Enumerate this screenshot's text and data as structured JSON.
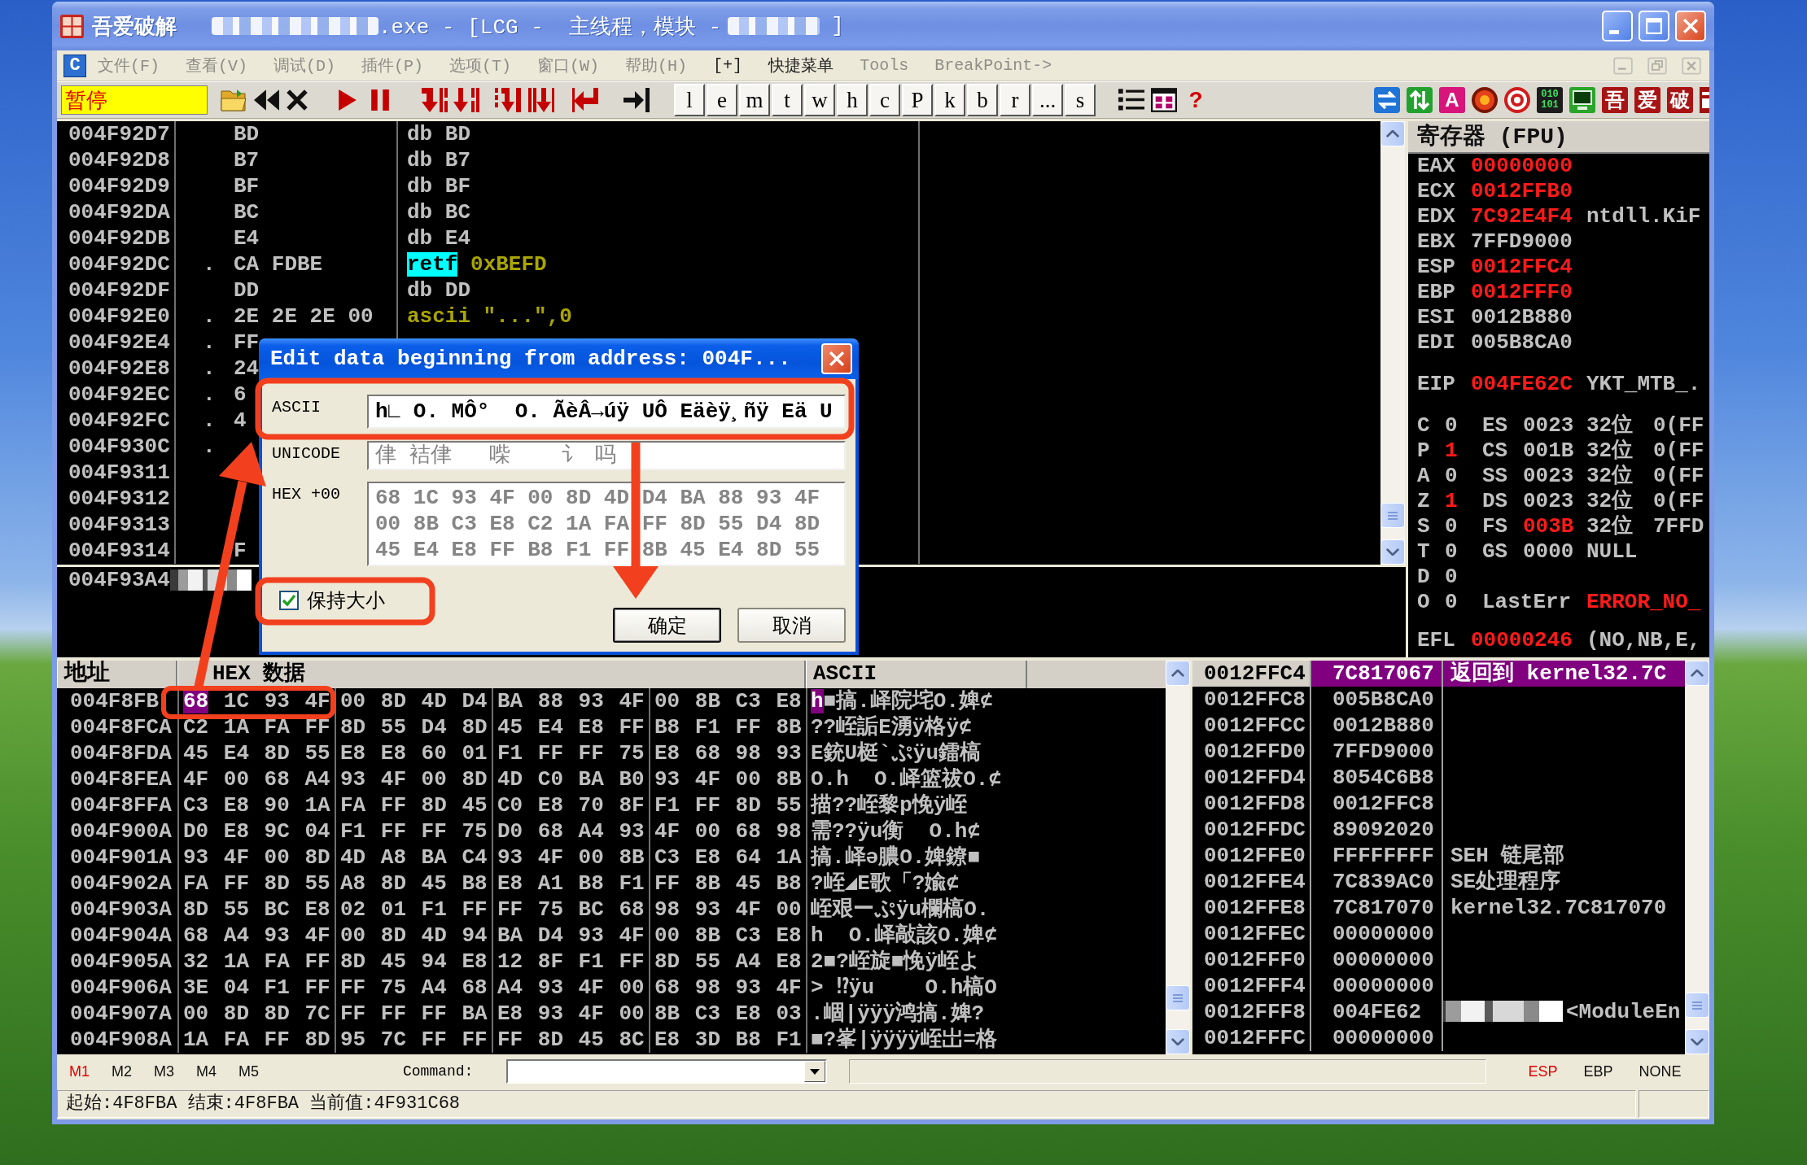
{
  "window": {
    "app_name": "吾爱破解",
    "title": [
      {
        "kind": "redacted"
      },
      {
        "kind": "text",
        "text": ".exe - [LCG -  主线程，模块 -"
      },
      {
        "kind": "redacted"
      },
      {
        "kind": "text",
        "text": "]"
      }
    ]
  },
  "menubar": {
    "window_button": "C",
    "items": [
      {
        "label": "文件(F)",
        "disabled": true
      },
      {
        "label": "查看(V)",
        "disabled": true
      },
      {
        "label": "调试(D)",
        "disabled": true
      },
      {
        "label": "插件(P)",
        "disabled": true
      },
      {
        "label": "选项(T)",
        "disabled": true
      },
      {
        "label": "窗口(W)",
        "disabled": true
      },
      {
        "label": "帮助(H)",
        "disabled": true
      },
      {
        "label": "[+]",
        "disabled": false
      },
      {
        "label": "快捷菜单",
        "disabled": false
      },
      {
        "label": "Tools",
        "disabled": true
      },
      {
        "label": "BreakPoint->",
        "disabled": true
      }
    ]
  },
  "toolbar": {
    "status": "暂停",
    "letters": [
      "l",
      "e",
      "m",
      "t",
      "w",
      "h",
      "c",
      "P",
      "k",
      "b",
      "r",
      "...",
      "s"
    ],
    "help": "?",
    "tiles": [
      "A",
      "010 101",
      "吾",
      "爱",
      "破"
    ]
  },
  "disassembly": {
    "rows": [
      {
        "address": "004F92D7",
        "hex": "BD",
        "code": [
          {
            "text": "db BD",
            "kind": "plain"
          }
        ]
      },
      {
        "address": "004F92D8",
        "hex": "B7",
        "code": [
          {
            "text": "db B7",
            "kind": "plain"
          }
        ]
      },
      {
        "address": "004F92D9",
        "hex": "BF",
        "code": [
          {
            "text": "db BF",
            "kind": "plain"
          }
        ]
      },
      {
        "address": "004F92DA",
        "hex": "BC",
        "code": [
          {
            "text": "db BC",
            "kind": "plain"
          }
        ]
      },
      {
        "address": "004F92DB",
        "hex": "E4",
        "code": [
          {
            "text": "db E4",
            "kind": "plain"
          }
        ]
      },
      {
        "address": "004F92DC",
        "marker": ".",
        "hex": "CA FDBE",
        "code": [
          {
            "text": "retf",
            "kind": "highlighted"
          },
          {
            "text": "0xBEFD",
            "kind": "constant"
          }
        ]
      },
      {
        "address": "004F92DF",
        "hex": "DD",
        "code": [
          {
            "text": "db DD",
            "kind": "plain"
          }
        ]
      },
      {
        "address": "004F92E0",
        "marker": ".",
        "hex": "2E 2E 2E 00",
        "code": [
          {
            "text": "ascii \"...\",0",
            "kind": "constant"
          }
        ]
      },
      {
        "address": "004F92E4",
        "marker": ".",
        "hex": "FF"
      },
      {
        "address": "004F92E8",
        "marker": ".",
        "hex": "24"
      },
      {
        "address": "004F92EC",
        "marker": ".",
        "hex": "6"
      },
      {
        "address": "004F92FC",
        "marker": ".",
        "hex": "4"
      },
      {
        "address": "004F930C",
        "marker": "."
      },
      {
        "address": "004F9311"
      },
      {
        "address": "004F9312"
      },
      {
        "address": "004F9313"
      },
      {
        "address": "004F9314",
        "hex": "F"
      }
    ]
  },
  "info_pane": {
    "address": "004F93A4",
    "redacted": true
  },
  "registers": {
    "title": "寄存器 (FPU)",
    "general": [
      {
        "name": "EAX",
        "value": "00000000",
        "changed": true
      },
      {
        "name": "ECX",
        "value": "0012FFB0",
        "changed": true
      },
      {
        "name": "EDX",
        "value": "7C92E4F4",
        "changed": true,
        "comment": "ntdll.KiF"
      },
      {
        "name": "EBX",
        "value": "7FFD9000",
        "changed": false
      },
      {
        "name": "ESP",
        "value": "0012FFC4",
        "changed": true
      },
      {
        "name": "EBP",
        "value": "0012FFF0",
        "changed": true
      },
      {
        "name": "ESI",
        "value": "0012B880",
        "changed": false
      },
      {
        "name": "EDI",
        "value": "005B8CA0",
        "changed": false
      }
    ],
    "eip": {
      "name": "EIP",
      "value": "004FE62C",
      "changed": true,
      "comment": "YKT_MTB_."
    },
    "flags": [
      {
        "name": "C",
        "value": "0",
        "changed": false,
        "segment": {
          "name": "ES",
          "selector": "0023",
          "changed": false,
          "width": "32位",
          "base": "0(FF"
        }
      },
      {
        "name": "P",
        "value": "1",
        "changed": true,
        "segment": {
          "name": "CS",
          "selector": "001B",
          "changed": false,
          "width": "32位",
          "base": "0(FF"
        }
      },
      {
        "name": "A",
        "value": "0",
        "changed": false,
        "segment": {
          "name": "SS",
          "selector": "0023",
          "changed": false,
          "width": "32位",
          "base": "0(FF"
        }
      },
      {
        "name": "Z",
        "value": "1",
        "changed": true,
        "segment": {
          "name": "DS",
          "selector": "0023",
          "changed": false,
          "width": "32位",
          "base": "0(FF"
        }
      },
      {
        "name": "S",
        "value": "0",
        "changed": false,
        "segment": {
          "name": "FS",
          "selector": "003B",
          "changed": true,
          "width": "32位",
          "base": "7FFD"
        }
      },
      {
        "name": "T",
        "value": "0",
        "changed": false,
        "segment": {
          "name": "GS",
          "selector": "0000",
          "changed": false,
          "width": "NULL"
        }
      },
      {
        "name": "D",
        "value": "0",
        "changed": false
      },
      {
        "name": "O",
        "value": "0",
        "changed": false,
        "last_error": {
          "label": "LastErr",
          "value": "ERROR_NO_",
          "changed": true
        }
      }
    ],
    "efl": {
      "name": "EFL",
      "value": "00000246",
      "changed": true,
      "comment": "(NO,NB,E,"
    }
  },
  "hex_dump": {
    "columns": [
      "地址",
      "HEX 数据",
      "ASCII"
    ],
    "rows": [
      {
        "address": "004F8FB",
        "groups": [
          [
            {
              "text": "68",
              "selected": true
            },
            {
              "text": "1C 93 4F",
              "selected": false
            }
          ],
          [
            {
              "text": "00 8D 4D D4",
              "selected": false
            }
          ],
          [
            {
              "text": "BA 88 93 4F",
              "selected": false
            }
          ],
          [
            {
              "text": "00 8B C3 E8",
              "selected": false
            }
          ]
        ],
        "ascii": [
          {
            "text": "h",
            "selected": true
          },
          {
            "text": "■搞.峄院垞O.婢⊄",
            "selected": false
          }
        ]
      },
      {
        "address": "004F8FCA",
        "groups": [
          [
            {
              "text": "C2 1A FA FF",
              "selected": false
            }
          ],
          [
            {
              "text": "8D 55 D4 8D",
              "selected": false
            }
          ],
          [
            {
              "text": "45 E4 E8 FF",
              "selected": false
            }
          ],
          [
            {
              "text": "B8 F1 FF 8B",
              "selected": false
            }
          ]
        ],
        "ascii": [
          {
            "text": "??峌詬E湧ÿ格ÿ⊄",
            "selected": false
          }
        ]
      },
      {
        "address": "004F8FDA",
        "groups": [
          [
            {
              "text": "45 E4 8D 55",
              "selected": false
            }
          ],
          [
            {
              "text": "E8 E8 60 01",
              "selected": false
            }
          ],
          [
            {
              "text": "F1 FF FF 75",
              "selected": false
            }
          ],
          [
            {
              "text": "E8 68 98 93",
              "selected": false
            }
          ]
        ],
        "ascii": [
          {
            "text": "E銃U梃`ぷÿu鐳槁",
            "selected": false
          }
        ]
      },
      {
        "address": "004F8FEA",
        "groups": [
          [
            {
              "text": "4F 00 68 A4",
              "selected": false
            }
          ],
          [
            {
              "text": "93 4F 00 8D",
              "selected": false
            }
          ],
          [
            {
              "text": "4D C0 BA B0",
              "selected": false
            }
          ],
          [
            {
              "text": "93 4F 00 8B",
              "selected": false
            }
          ]
        ],
        "ascii": [
          {
            "text": "O.h  O.峄篮祓O.⊄",
            "selected": false
          }
        ]
      },
      {
        "address": "004F8FFA",
        "groups": [
          [
            {
              "text": "C3 E8 90 1A",
              "selected": false
            }
          ],
          [
            {
              "text": "FA FF 8D 45",
              "selected": false
            }
          ],
          [
            {
              "text": "C0 E8 70 8F",
              "selected": false
            }
          ],
          [
            {
              "text": "F1 FF 8D 55",
              "selected": false
            }
          ]
        ],
        "ascii": [
          {
            "text": "描??峌黎p悗ÿ峌",
            "selected": false
          }
        ]
      },
      {
        "address": "004F900A",
        "groups": [
          [
            {
              "text": "D0 E8 9C 04",
              "selected": false
            }
          ],
          [
            {
              "text": "F1 FF FF 75",
              "selected": false
            }
          ],
          [
            {
              "text": "D0 68 A4 93",
              "selected": false
            }
          ],
          [
            {
              "text": "4F 00 68 98",
              "selected": false
            }
          ]
        ],
        "ascii": [
          {
            "text": "需??ÿu衡  O.h⊄",
            "selected": false
          }
        ]
      },
      {
        "address": "004F901A",
        "groups": [
          [
            {
              "text": "93 4F 00 8D",
              "selected": false
            }
          ],
          [
            {
              "text": "4D A8 BA C4",
              "selected": false
            }
          ],
          [
            {
              "text": "93 4F 00 8B",
              "selected": false
            }
          ],
          [
            {
              "text": "C3 E8 64 1A",
              "selected": false
            }
          ]
        ],
        "ascii": [
          {
            "text": "搞.峄ə膿O.婢鐐■",
            "selected": false
          }
        ]
      },
      {
        "address": "004F902A",
        "groups": [
          [
            {
              "text": "FA FF 8D 55",
              "selected": false
            }
          ],
          [
            {
              "text": "A8 8D 45 B8",
              "selected": false
            }
          ],
          [
            {
              "text": "E8 A1 B8 F1",
              "selected": false
            }
          ],
          [
            {
              "text": "FF 8B 45 B8",
              "selected": false
            }
          ]
        ],
        "ascii": [
          {
            "text": "?峌◢E歌「?婾⊄",
            "selected": false
          }
        ]
      },
      {
        "address": "004F903A",
        "groups": [
          [
            {
              "text": "8D 55 BC E8",
              "selected": false
            }
          ],
          [
            {
              "text": "02 01 F1 FF",
              "selected": false
            }
          ],
          [
            {
              "text": "FF 75 BC 68",
              "selected": false
            }
          ],
          [
            {
              "text": "98 93 4F 00",
              "selected": false
            }
          ]
        ],
        "ascii": [
          {
            "text": "峌艰ーぷÿu欄槁O.",
            "selected": false
          }
        ]
      },
      {
        "address": "004F904A",
        "groups": [
          [
            {
              "text": "68 A4 93 4F",
              "selected": false
            }
          ],
          [
            {
              "text": "00 8D 4D 94",
              "selected": false
            }
          ],
          [
            {
              "text": "BA D4 93 4F",
              "selected": false
            }
          ],
          [
            {
              "text": "00 8B C3 E8",
              "selected": false
            }
          ]
        ],
        "ascii": [
          {
            "text": "h  O.峄敲該O.婢⊄",
            "selected": false
          }
        ]
      },
      {
        "address": "004F905A",
        "groups": [
          [
            {
              "text": "32 1A FA FF",
              "selected": false
            }
          ],
          [
            {
              "text": "8D 45 94 E8",
              "selected": false
            }
          ],
          [
            {
              "text": "12 8F F1 FF",
              "selected": false
            }
          ],
          [
            {
              "text": "8D 55 A4 E8",
              "selected": false
            }
          ]
        ],
        "ascii": [
          {
            "text": "2■?峌旋■悗ÿ峌よ",
            "selected": false
          }
        ]
      },
      {
        "address": "004F906A",
        "groups": [
          [
            {
              "text": "3E 04 F1 FF",
              "selected": false
            }
          ],
          [
            {
              "text": "FF 75 A4 68",
              "selected": false
            }
          ],
          [
            {
              "text": "A4 93 4F 00",
              "selected": false
            }
          ],
          [
            {
              "text": "68 98 93 4F",
              "selected": false
            }
          ]
        ],
        "ascii": [
          {
            "text": "> ⁉ÿu    O.h槁O",
            "selected": false
          }
        ]
      },
      {
        "address": "004F907A",
        "groups": [
          [
            {
              "text": "00 8D 8D 7C",
              "selected": false
            }
          ],
          [
            {
              "text": "FF FF FF BA",
              "selected": false
            }
          ],
          [
            {
              "text": "E8 93 4F 00",
              "selected": false
            }
          ],
          [
            {
              "text": "8B C3 E8 03",
              "selected": false
            }
          ]
        ],
        "ascii": [
          {
            "text": ".崓|ÿÿÿ鸿搞.婢?",
            "selected": false
          }
        ]
      },
      {
        "address": "004F908A",
        "groups": [
          [
            {
              "text": "1A FA FF 8D",
              "selected": false
            }
          ],
          [
            {
              "text": "95 7C FF FF",
              "selected": false
            }
          ],
          [
            {
              "text": "FF 8D 45 8C",
              "selected": false
            }
          ],
          [
            {
              "text": "E8 3D B8 F1",
              "selected": false
            }
          ]
        ],
        "ascii": [
          {
            "text": "■?峯|ÿÿÿÿ峌岀=格",
            "selected": false
          }
        ]
      }
    ]
  },
  "stack": {
    "rows": [
      {
        "address": "0012FFC4",
        "value": "7C817067",
        "comment": "返回到 kernel32.7C",
        "selected": true,
        "redacted": false
      },
      {
        "address": "0012FFC8",
        "value": "005B8CA0",
        "selected": false,
        "redacted": false
      },
      {
        "address": "0012FFCC",
        "value": "0012B880",
        "selected": false,
        "redacted": false
      },
      {
        "address": "0012FFD0",
        "value": "7FFD9000",
        "selected": false,
        "redacted": false
      },
      {
        "address": "0012FFD4",
        "value": "8054C6B8",
        "selected": false,
        "redacted": false
      },
      {
        "address": "0012FFD8",
        "value": "0012FFC8",
        "selected": false,
        "redacted": false
      },
      {
        "address": "0012FFDC",
        "value": "89092020",
        "selected": false,
        "redacted": false
      },
      {
        "address": "0012FFE0",
        "value": "FFFFFFFF",
        "comment": "SEH 链尾部",
        "selected": false,
        "redacted": false
      },
      {
        "address": "0012FFE4",
        "value": "7C839AC0",
        "comment": "SE处理程序",
        "selected": false,
        "redacted": false
      },
      {
        "address": "0012FFE8",
        "value": "7C817070",
        "comment": "kernel32.7C817070",
        "selected": false,
        "redacted": false
      },
      {
        "address": "0012FFEC",
        "value": "00000000",
        "selected": false,
        "redacted": false
      },
      {
        "address": "0012FFF0",
        "value": "00000000",
        "selected": false,
        "redacted": false
      },
      {
        "address": "0012FFF4",
        "value": "00000000",
        "selected": false,
        "redacted": false
      },
      {
        "address": "0012FFF8",
        "value": "004FE62",
        "comment": "<ModuleEn",
        "selected": false,
        "redacted": true
      },
      {
        "address": "0012FFFC",
        "value": "00000000",
        "selected": false,
        "redacted": false
      }
    ]
  },
  "dialog": {
    "title": "Edit data beginning from address: 004F...",
    "fields": [
      {
        "label": "ASCII",
        "lines": [
          "h∟ O. MÔ°  O. ÃèÂ→úÿ UÔ Eäèÿ¸ñÿ Eä U"
        ],
        "disabled": false
      },
      {
        "label": "UNICODE",
        "lines": [
          "侓 袺侓   喍    讠 吗"
        ],
        "disabled": true
      },
      {
        "label": "HEX +00",
        "lines": [
          "68 1C 93 4F 00 8D 4D D4 BA 88 93 4F",
          "00 8B C3 E8 C2 1A FA FF 8D 55 D4 8D",
          "45 E4 E8 FF B8 F1 FF 8B 45 E4 8D 55"
        ],
        "disabled": true
      }
    ],
    "checkbox": {
      "label": "保持大小",
      "checked": true
    },
    "buttons": [
      {
        "label": "确定",
        "default": true
      },
      {
        "label": "取消",
        "default": false
      }
    ]
  },
  "command_bar": {
    "marks": [
      {
        "label": "M1",
        "selected": true
      },
      {
        "label": "M2",
        "selected": false
      },
      {
        "label": "M3",
        "selected": false
      },
      {
        "label": "M4",
        "selected": false
      },
      {
        "label": "M5",
        "selected": false
      }
    ],
    "command_label": "Command:",
    "stack_modes": [
      {
        "label": "ESP",
        "selected": true
      },
      {
        "label": "EBP",
        "selected": false
      },
      {
        "label": "NONE",
        "selected": false
      }
    ]
  },
  "status_bar": {
    "text": "起始:4F8FBA 结束:4F8FBA 当前值:4F931C68"
  }
}
